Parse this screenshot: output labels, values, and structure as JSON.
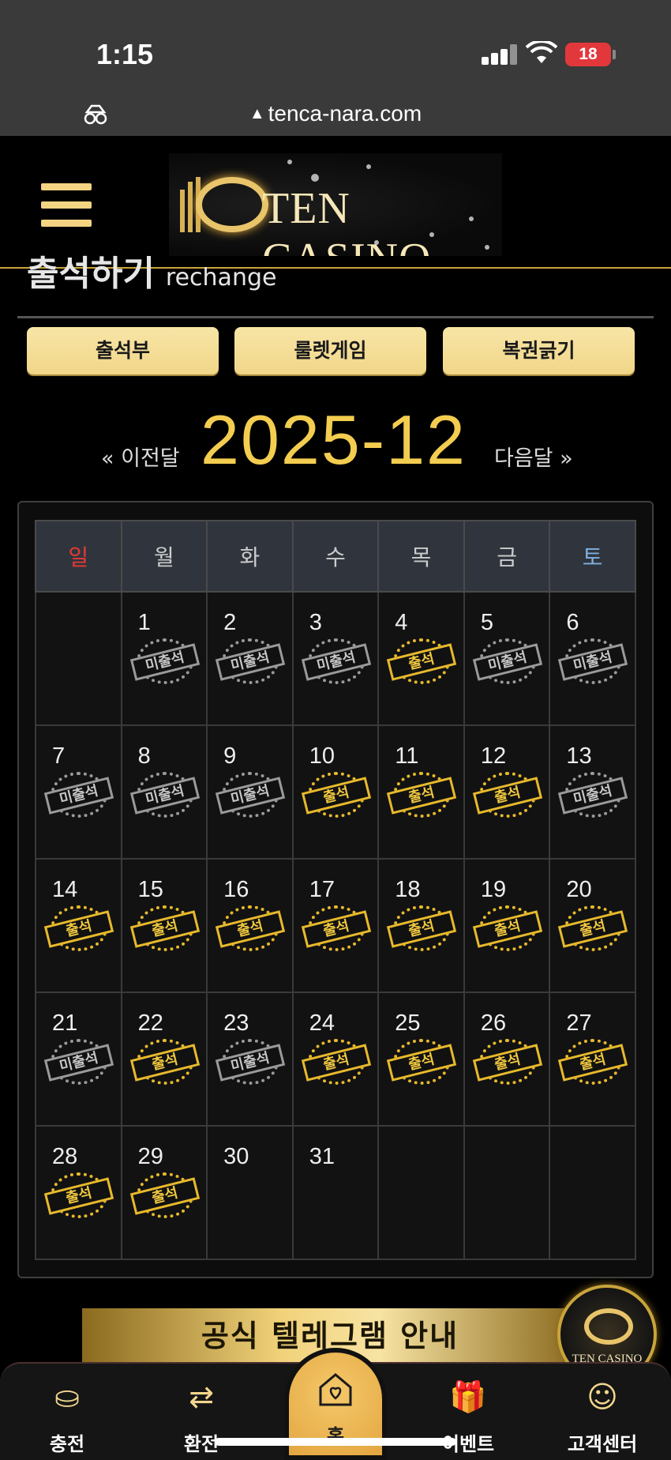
{
  "status_bar": {
    "time": "1:15",
    "battery": "18"
  },
  "browser": {
    "url": "tenca-nara.com"
  },
  "header": {
    "logo_text": "TEN CASINO"
  },
  "section": {
    "title_ko": "출석하기",
    "title_en": "rechange"
  },
  "tabs": [
    {
      "label": "출석부"
    },
    {
      "label": "룰렛게임"
    },
    {
      "label": "복권긁기"
    }
  ],
  "calendar": {
    "prev_label": "« 이전달",
    "month": "2025-12",
    "next_label": "다음달 »",
    "weekdays": [
      "일",
      "월",
      "화",
      "수",
      "목",
      "금",
      "토"
    ],
    "attended_label": "출석",
    "absent_label": "미출석",
    "weeks": [
      [
        null,
        {
          "d": "1",
          "s": "absent"
        },
        {
          "d": "2",
          "s": "absent"
        },
        {
          "d": "3",
          "s": "absent"
        },
        {
          "d": "4",
          "s": "attended"
        },
        {
          "d": "5",
          "s": "absent"
        },
        {
          "d": "6",
          "s": "absent"
        }
      ],
      [
        {
          "d": "7",
          "s": "absent"
        },
        {
          "d": "8",
          "s": "absent"
        },
        {
          "d": "9",
          "s": "absent"
        },
        {
          "d": "10",
          "s": "attended"
        },
        {
          "d": "11",
          "s": "attended"
        },
        {
          "d": "12",
          "s": "attended"
        },
        {
          "d": "13",
          "s": "absent"
        }
      ],
      [
        {
          "d": "14",
          "s": "attended"
        },
        {
          "d": "15",
          "s": "attended"
        },
        {
          "d": "16",
          "s": "attended"
        },
        {
          "d": "17",
          "s": "attended"
        },
        {
          "d": "18",
          "s": "attended"
        },
        {
          "d": "19",
          "s": "attended"
        },
        {
          "d": "20",
          "s": "attended"
        }
      ],
      [
        {
          "d": "21",
          "s": "absent"
        },
        {
          "d": "22",
          "s": "attended"
        },
        {
          "d": "23",
          "s": "absent"
        },
        {
          "d": "24",
          "s": "attended"
        },
        {
          "d": "25",
          "s": "attended"
        },
        {
          "d": "26",
          "s": "attended"
        },
        {
          "d": "27",
          "s": "attended"
        }
      ],
      [
        {
          "d": "28",
          "s": "attended"
        },
        {
          "d": "29",
          "s": "attended"
        },
        {
          "d": "30",
          "s": ""
        },
        {
          "d": "31",
          "s": ""
        },
        null,
        null,
        null
      ]
    ]
  },
  "banner": {
    "text": "공식 텔레그램 안내"
  },
  "float_logo": {
    "text": "TEN CASINO"
  },
  "bottom_nav": [
    {
      "label": "충전",
      "icon": "charge-icon"
    },
    {
      "label": "환전",
      "icon": "exchange-icon"
    },
    {
      "label": "홈",
      "icon": "home-heart-icon"
    },
    {
      "label": "이벤트",
      "icon": "gift-icon"
    },
    {
      "label": "고객센터",
      "icon": "support-icon"
    }
  ],
  "colors": {
    "accent_gold": "#f3cd4f",
    "button_gold": "#f0d689",
    "sunday": "#e53935",
    "saturday": "#7fb0e0"
  }
}
